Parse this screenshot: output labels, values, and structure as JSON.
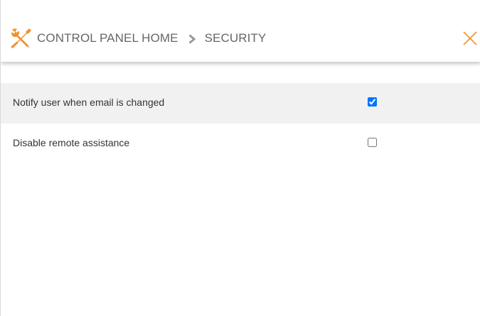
{
  "header": {
    "breadcrumb": {
      "home": "CONTROL PANEL HOME",
      "current": "SECURITY"
    },
    "icon": "tools-icon",
    "close_icon": "close-icon",
    "accent_color": "#f0922b"
  },
  "settings": [
    {
      "label": "Notify user when email is changed",
      "checked": true
    },
    {
      "label": "Disable remote assistance",
      "checked": false
    }
  ]
}
